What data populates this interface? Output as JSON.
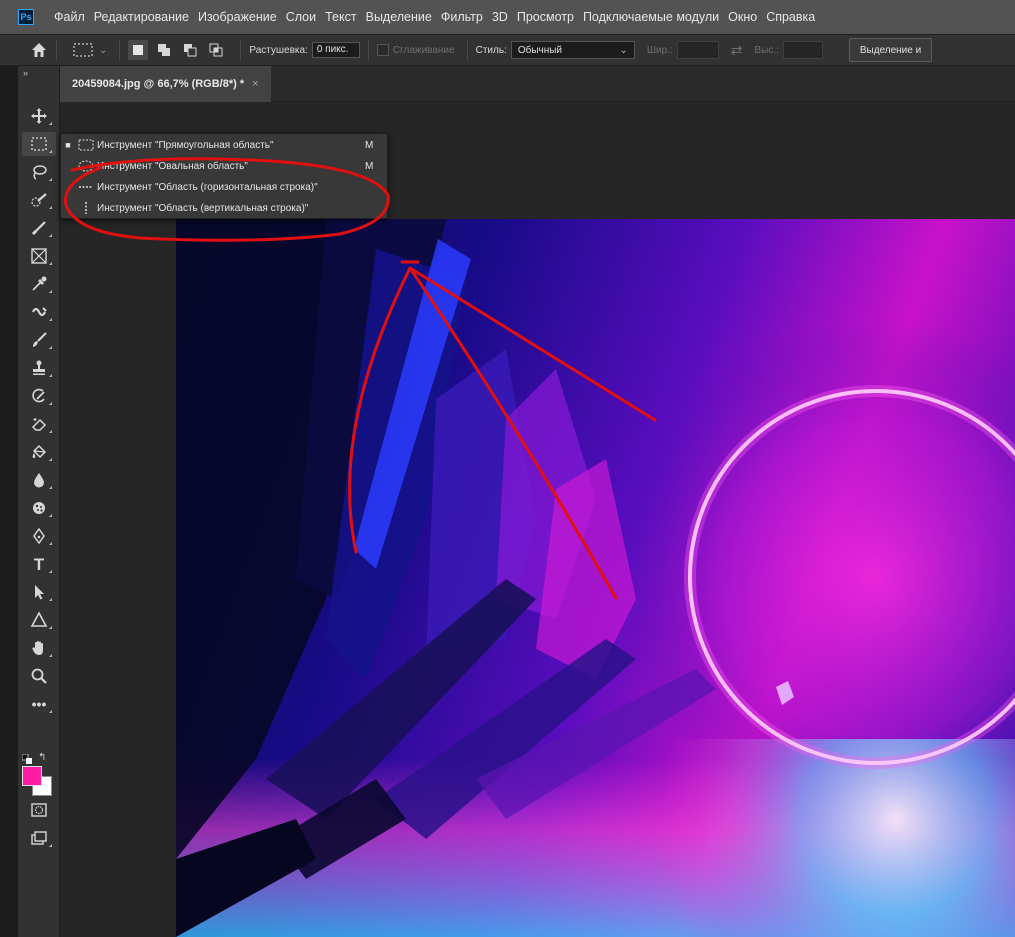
{
  "app": {
    "logo": "Ps"
  },
  "menu": [
    "Файл",
    "Редактирование",
    "Изображение",
    "Слои",
    "Текст",
    "Выделение",
    "Фильтр",
    "3D",
    "Просмотр",
    "Подключаемые модули",
    "Окно",
    "Справка"
  ],
  "options": {
    "feather_label": "Растушевка:",
    "feather_value": "0 пикс.",
    "antialias_label": "Сглаживание",
    "style_label": "Стиль:",
    "style_value": "Обычный",
    "width_label": "Шир.:",
    "height_label": "Выс.:",
    "select_mask_button": "Выделение и"
  },
  "document": {
    "tab_title": "20459084.jpg @ 66,7% (RGB/8*) *",
    "close": "×"
  },
  "flyout": {
    "items": [
      {
        "label": "Инструмент \"Прямоугольная область\"",
        "shortcut": "M",
        "selected": true,
        "icon": "rectangular-marquee-icon"
      },
      {
        "label": "Инструмент \"Овальная область\"",
        "shortcut": "M",
        "selected": false,
        "icon": "elliptical-marquee-icon"
      },
      {
        "label": "Инструмент \"Область (горизонтальная строка)\"",
        "shortcut": "",
        "selected": false,
        "icon": "single-row-marquee-icon"
      },
      {
        "label": "Инструмент \"Область (вертикальная строка)\"",
        "shortcut": "",
        "selected": false,
        "icon": "single-column-marquee-icon"
      }
    ]
  },
  "colors": {
    "foreground": "#ff1aa3",
    "background": "#ffffff",
    "annotation": "#e01010"
  }
}
